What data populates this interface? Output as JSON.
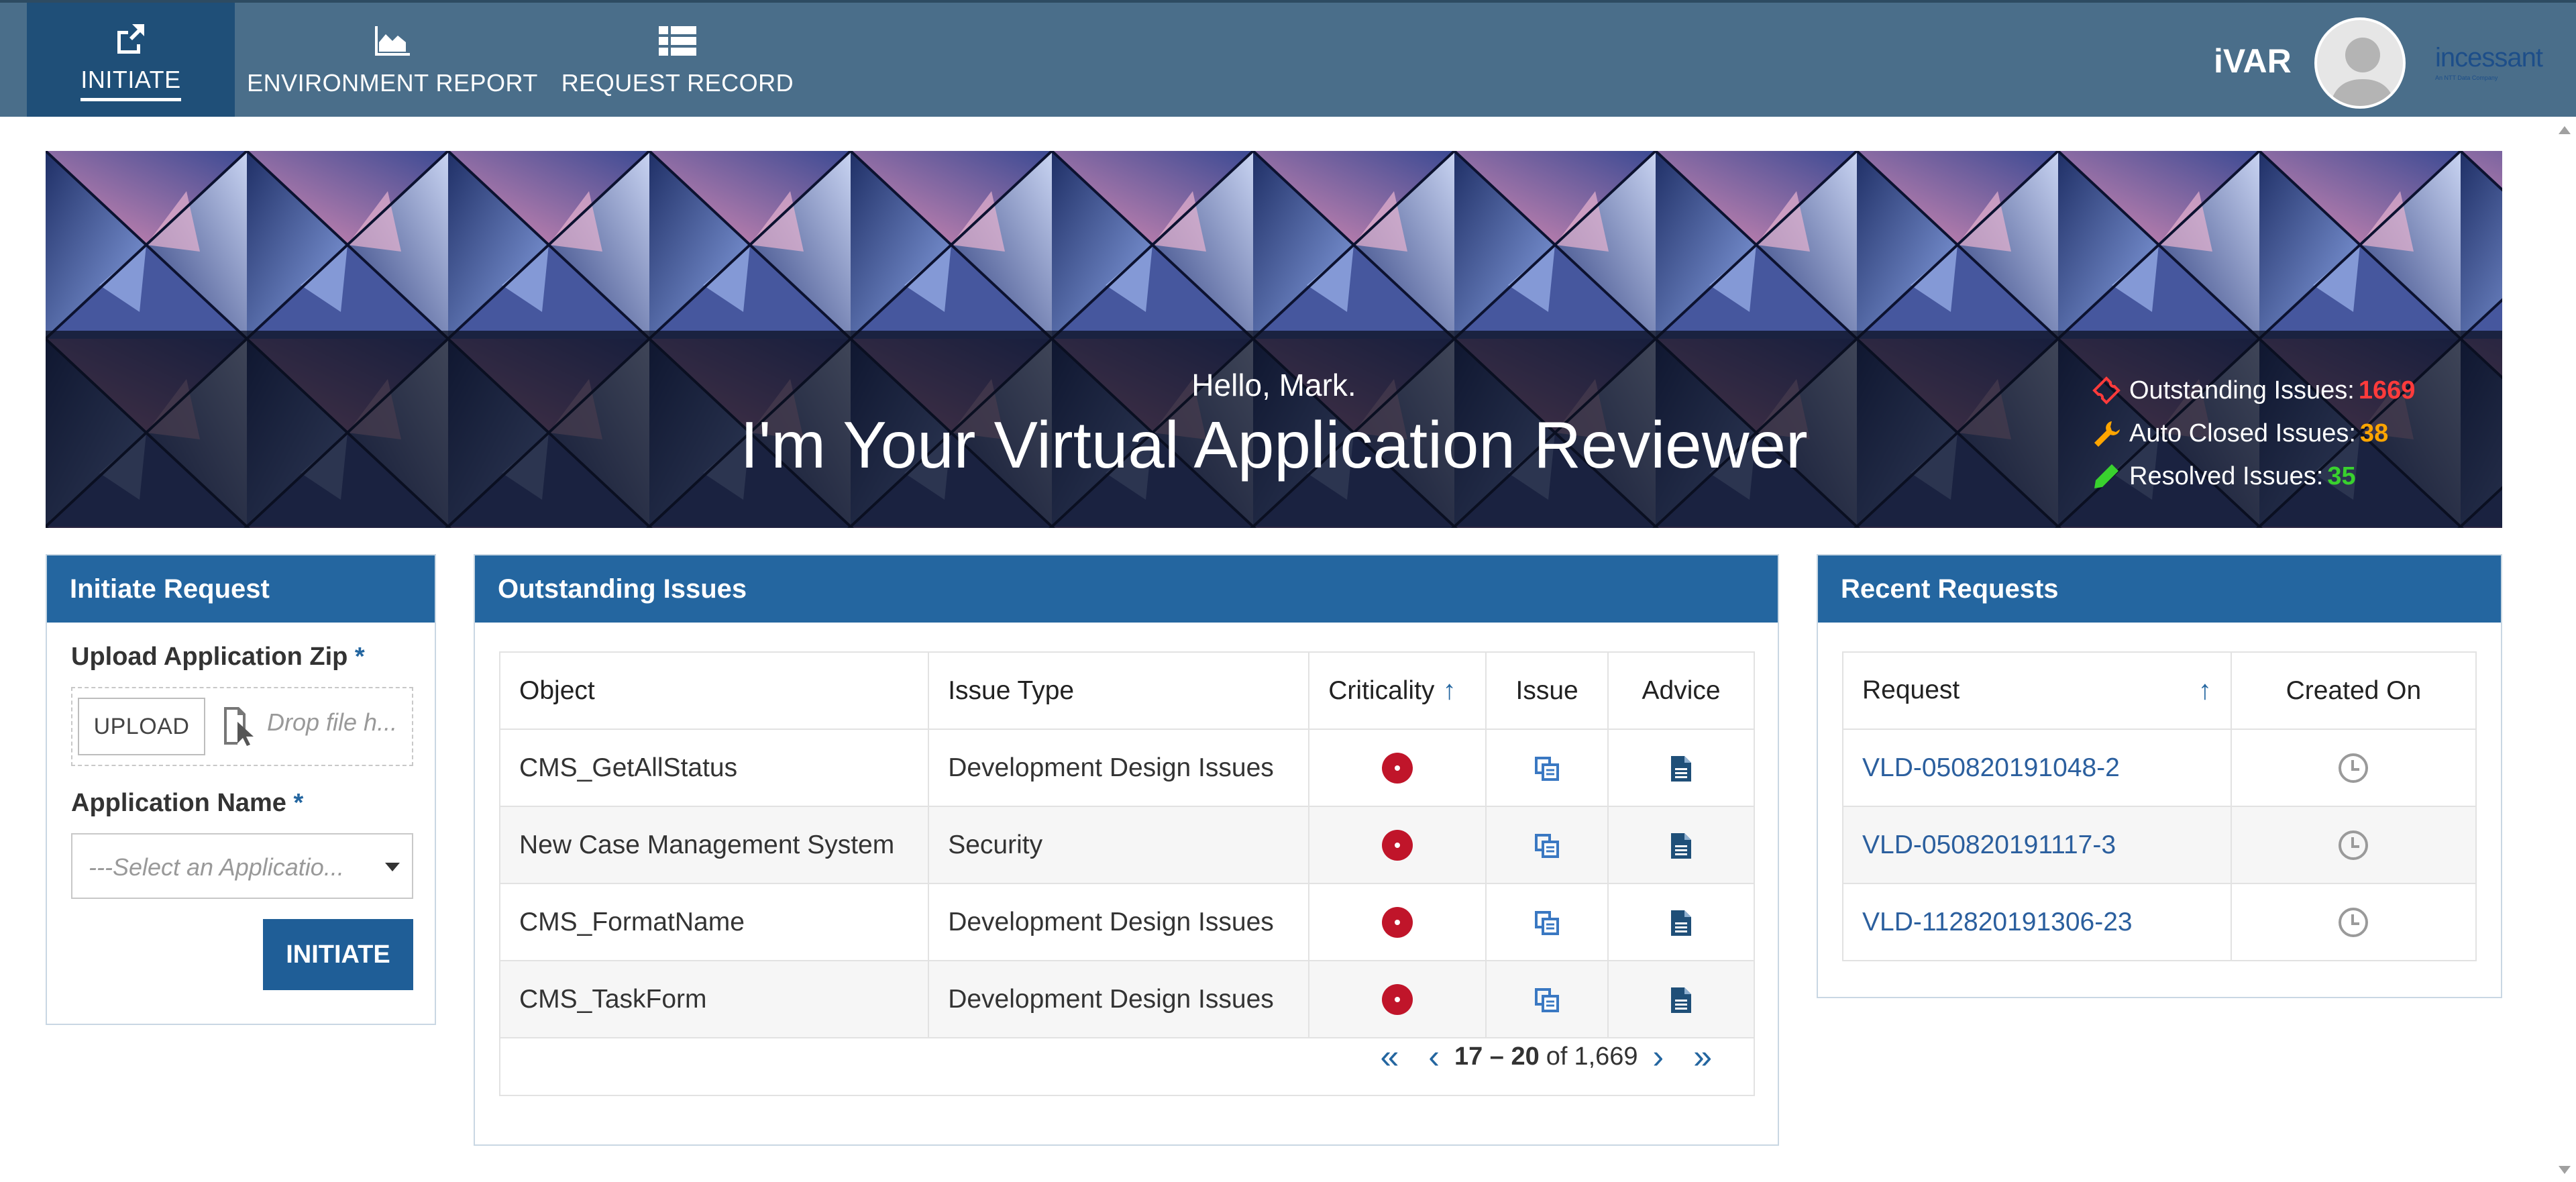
{
  "nav": {
    "items": [
      {
        "label": "INITIATE",
        "icon": "share-icon",
        "active": true
      },
      {
        "label": "ENVIRONMENT REPORT",
        "icon": "area-chart-icon"
      },
      {
        "label": "REQUEST RECORD",
        "icon": "list-icon"
      }
    ],
    "app_name": "iVAR",
    "brand": "incessant",
    "brand_sub": "An NTT Data Company"
  },
  "banner": {
    "greeting": "Hello, Mark.",
    "headline": "I'm Your Virtual Application Reviewer",
    "stats": [
      {
        "label": "Outstanding Issues:",
        "value": "1669",
        "color": "#ff3b3b",
        "icon": "ticket-icon"
      },
      {
        "label": "Auto Closed Issues:",
        "value": "38",
        "color": "#ffa500",
        "icon": "wrench-icon"
      },
      {
        "label": "Resolved Issues:",
        "value": "35",
        "color": "#39d12e",
        "icon": "pencil-icon"
      }
    ]
  },
  "initiate": {
    "title": "Initiate Request",
    "upload_label": "Upload Application Zip",
    "required_mark": "*",
    "upload_button": "UPLOAD",
    "drop_placeholder": "Drop file h...",
    "app_name_label": "Application Name",
    "app_select_placeholder": "---Select an Applicatio...",
    "initiate_button": "INITIATE"
  },
  "issues": {
    "title": "Outstanding Issues",
    "columns": [
      "Object",
      "Issue Type",
      "Criticality",
      "Issue",
      "Advice"
    ],
    "sort_glyph": "↑",
    "rows": [
      {
        "object": "CMS_GetAllStatus",
        "type": "Development Design Issues",
        "criticality": "high"
      },
      {
        "object": "New Case Management System",
        "type": "Security",
        "criticality": "high"
      },
      {
        "object": "CMS_FormatName",
        "type": "Development Design Issues",
        "criticality": "high"
      },
      {
        "object": "CMS_TaskForm",
        "type": "Development Design Issues",
        "criticality": "high"
      }
    ],
    "pager": {
      "first": "«",
      "prev": "‹",
      "range": "17 – 20",
      "of": "of",
      "total": "1,669",
      "next": "›",
      "last": "»"
    }
  },
  "recent": {
    "title": "Recent Requests",
    "columns": [
      "Request",
      "Created On"
    ],
    "sort_glyph": "↑",
    "rows": [
      {
        "request": "VLD-050820191048-2"
      },
      {
        "request": "VLD-050820191117-3"
      },
      {
        "request": "VLD-112820191306-23"
      }
    ]
  },
  "colors": {
    "header": "#4a6e8a",
    "panel_head": "#2466a0",
    "critical": "#c0152a"
  }
}
